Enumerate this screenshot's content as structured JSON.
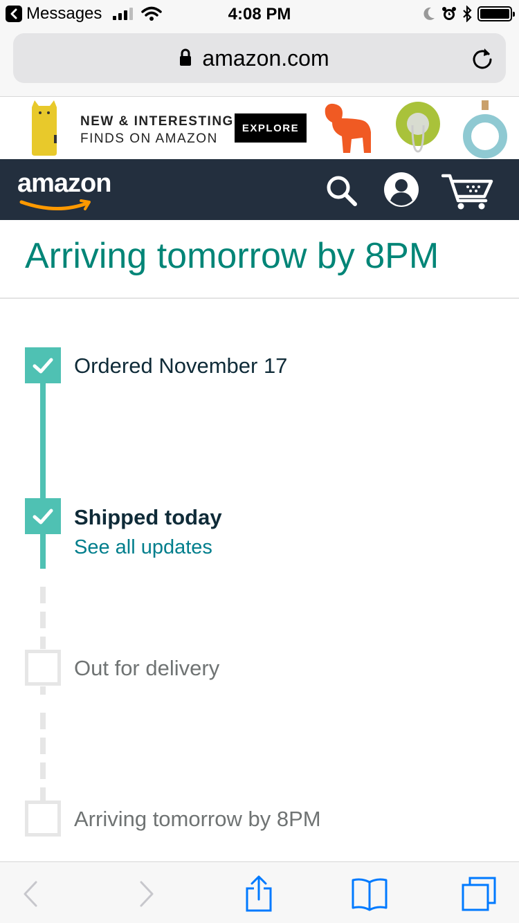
{
  "status_bar": {
    "back_app": "Messages",
    "time": "4:08 PM"
  },
  "browser": {
    "url": "amazon.com"
  },
  "banner": {
    "line1": "NEW & INTERESTING",
    "line2": "FINDS ON AMAZON",
    "cta": "EXPLORE"
  },
  "nav": {
    "logo_text": "amazon"
  },
  "page": {
    "heading": "Arriving tomorrow by 8PM"
  },
  "timeline": {
    "steps": [
      {
        "label": "Ordered November 17",
        "status": "done"
      },
      {
        "label": "Shipped today",
        "status": "done",
        "link": "See all updates"
      },
      {
        "label": "Out for delivery",
        "status": "pending"
      },
      {
        "label": "Arriving tomorrow by 8PM",
        "status": "pending"
      }
    ]
  },
  "colors": {
    "accent_teal": "#008577",
    "timeline_teal": "#4fc1b3",
    "link_teal": "#007e8c",
    "nav_bg": "#232f3e",
    "amazon_orange": "#ff9900",
    "ios_blue": "#007aff"
  },
  "icons": {
    "status": [
      "back-arrow-icon",
      "signal-icon",
      "wifi-icon",
      "moon-icon",
      "alarm-icon",
      "bluetooth-icon",
      "battery-icon"
    ],
    "browser": [
      "lock-icon",
      "reload-icon"
    ],
    "nav": [
      "search-icon",
      "account-icon",
      "cart-icon"
    ],
    "toolbar": [
      "back-icon",
      "forward-icon",
      "share-icon",
      "bookmarks-icon",
      "tabs-icon"
    ]
  }
}
